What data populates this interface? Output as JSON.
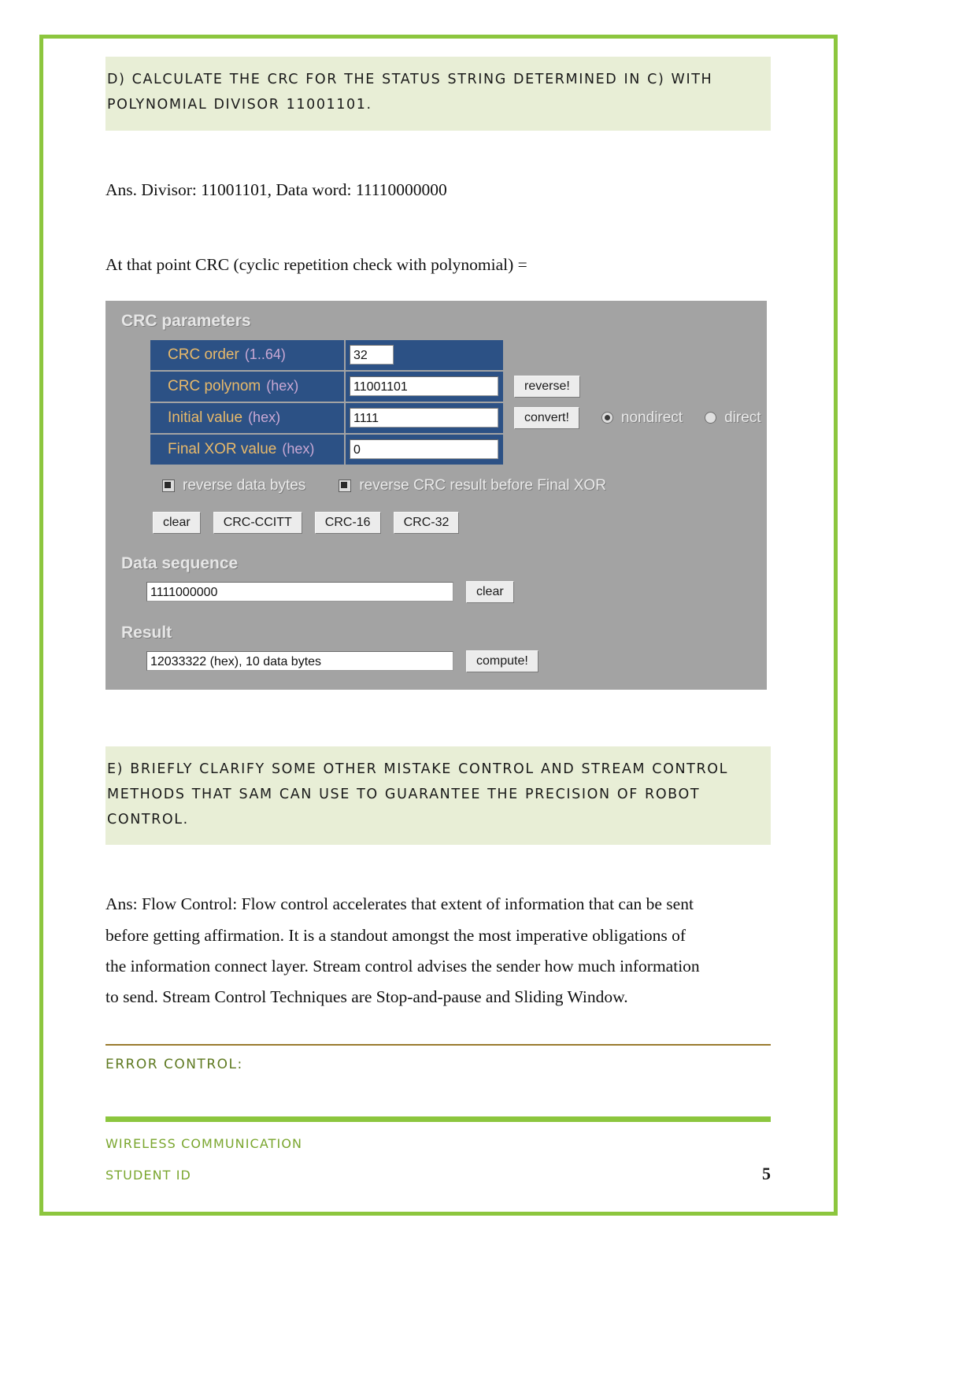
{
  "document": {
    "page_number": "5"
  },
  "headings": {
    "d_line1": "d) Calculate the CRC for the status string determined in c) with",
    "d_line2": "polynomial divisor 11001101.",
    "e_line1": "e) Briefly clarify some other mistake control and stream control",
    "e_line2": "methods that Sam can use to guarantee the precision of robot",
    "e_line3": "control.",
    "error_control": "Error Control:"
  },
  "body": {
    "ans_divisor": "Ans. Divisor: 11001101, Data word: 11110000000",
    "crc_intro": "At that point CRC (cyclic repetition check with polynomial) =",
    "flow_control_p1": "Ans: Flow Control: Flow control accelerates that extent of information that can be sent",
    "flow_control_p2": "before getting affirmation. It is a standout amongst the most imperative obligations of",
    "flow_control_p3": "the information connect layer. Stream control advises the sender how much information",
    "flow_control_p4": "to send. Stream Control Techniques are Stop-and-pause and Sliding Window."
  },
  "crc_tool": {
    "parameters_title": "CRC parameters",
    "fields": [
      {
        "label": "CRC order",
        "hint": "(1..64)",
        "value": "32"
      },
      {
        "label": "CRC polynom",
        "hint": "(hex)",
        "value": "11001101"
      },
      {
        "label": "Initial value",
        "hint": "(hex)",
        "value": "1111"
      },
      {
        "label": "Final XOR value",
        "hint": "(hex)",
        "value": "0"
      }
    ],
    "reverse_button": "reverse!",
    "convert_button": "convert!",
    "radio_nondirect": "nondirect",
    "radio_direct": "direct",
    "radio_selected": "nondirect",
    "checkbox_reverse_data": "reverse data bytes",
    "checkbox_reverse_crc": "reverse CRC result before Final XOR",
    "checkbox_reverse_data_checked": true,
    "checkbox_reverse_crc_checked": true,
    "preset_buttons": [
      "clear",
      "CRC-CCITT",
      "CRC-16",
      "CRC-32"
    ],
    "data_sequence_title": "Data sequence",
    "data_sequence_value": "1111000000",
    "data_sequence_clear": "clear",
    "result_title": "Result",
    "result_value": "12033322 (hex), 10 data bytes",
    "compute_button": "compute!"
  },
  "footer": {
    "course": "Wireless Communication",
    "student": "Student ID"
  },
  "colors": {
    "page_border": "#8cc63e",
    "heading_bg": "#e8eed6",
    "footer_text": "#7aa62e",
    "tool_bg": "#a3a3a3",
    "tool_row": "#2c5185",
    "tool_label": "#e8b96a"
  }
}
